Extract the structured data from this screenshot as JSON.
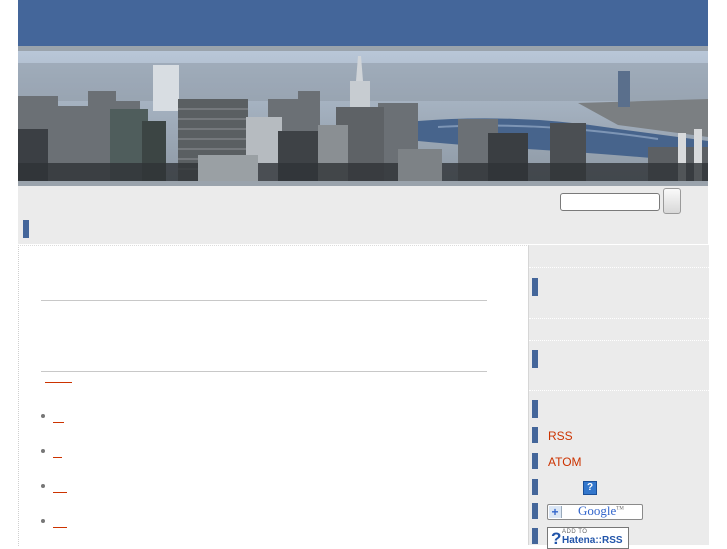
{
  "colors": {
    "header_blue": "#44669a",
    "link": "#cc3300",
    "sidebar_bg": "#ebebeb",
    "divider": "#9aa3ac"
  },
  "header": {
    "banner_image": "city-skyline-photo"
  },
  "search": {
    "value": "",
    "button_label": ""
  },
  "feeds": {
    "rss_label": "RSS",
    "atom_label": "ATOM",
    "help_icon_glyph": "?"
  },
  "badges": {
    "google_plus": "+",
    "google_word": "Google",
    "google_tm": "TM",
    "hatena_q": "?",
    "hatena_top": "ADD TO",
    "hatena_main": "Hatena::RSS"
  },
  "icons": [
    "section-marker-icon",
    "help-icon",
    "google-add-badge",
    "hatena-rss-badge"
  ]
}
